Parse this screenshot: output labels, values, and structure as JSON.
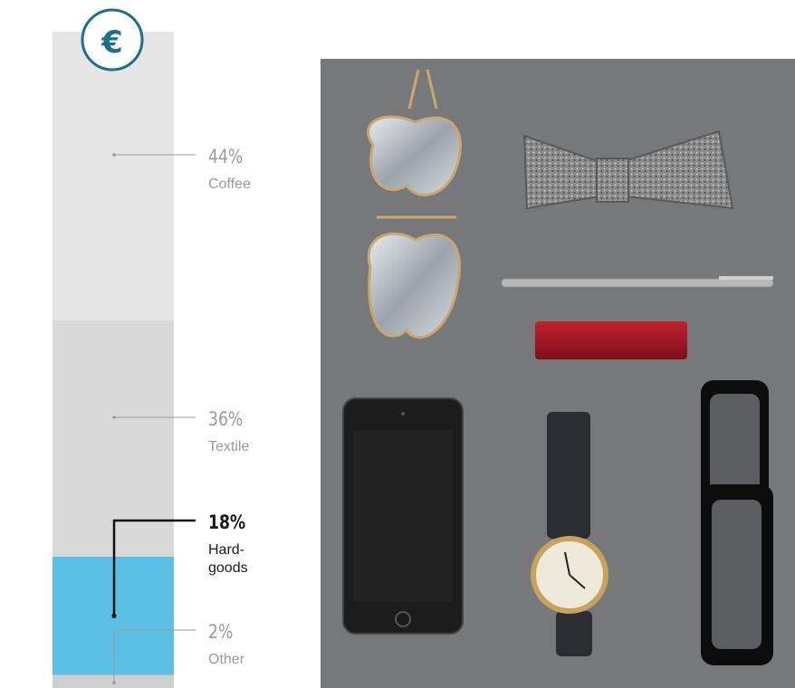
{
  "icon": {
    "name": "euro-icon",
    "symbol": "€",
    "color": "#1e6e8c"
  },
  "colors": {
    "coffee": "#e6e6e6",
    "textile": "#d9d9d9",
    "hardgoods": "#5bc0e4",
    "other": "#cfcfcf",
    "muted_text": "#9a9a9a",
    "dark_text": "#1a1a1a"
  },
  "chart_data": {
    "type": "bar",
    "stacked": true,
    "unit": "%",
    "categories": [
      "Coffee",
      "Textile",
      "Hard-\ngoods",
      "Other"
    ],
    "values": [
      44,
      36,
      18,
      2
    ],
    "labels": [
      "44%",
      "36%",
      "18%",
      "2%"
    ],
    "highlight": "Hard-\ngoods",
    "total": 100
  },
  "photo": {
    "subject": "flat-lay-accessories",
    "items": [
      "aviator-sunglasses",
      "bow-tie",
      "pen",
      "lighter",
      "smartphone",
      "wristwatch",
      "black-glasses"
    ]
  }
}
